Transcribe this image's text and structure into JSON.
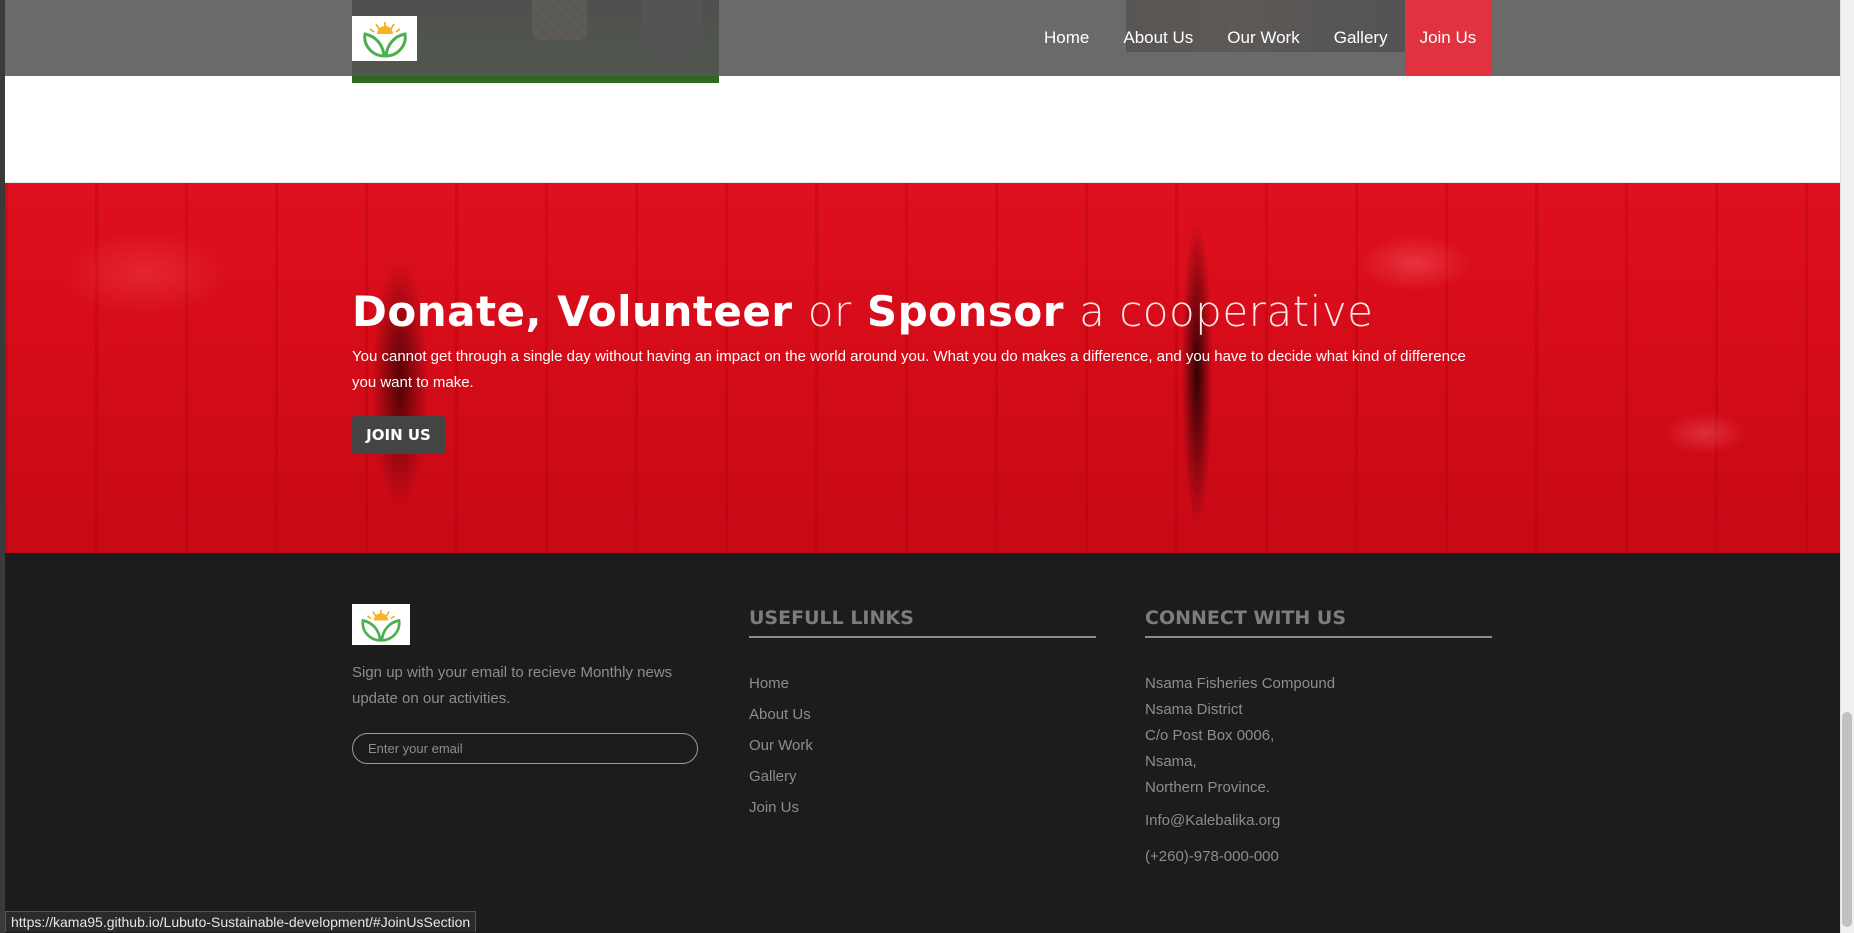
{
  "nav": {
    "items": [
      {
        "label": "Home"
      },
      {
        "label": "About Us"
      },
      {
        "label": "Our Work"
      },
      {
        "label": "Gallery"
      },
      {
        "label": "Join Us"
      }
    ]
  },
  "donate": {
    "title_bold_1": "Donate, Volunteer",
    "title_light_1": "or",
    "title_bold_2": "Sponsor",
    "title_light_2": "a cooperative",
    "text": "You cannot get through a single day without having an impact on the world around you. What you do makes a difference, and you have to decide what kind of difference you want to make.",
    "button_label": "JOIN US"
  },
  "footer": {
    "signup_text": "Sign up with your email to recieve Monthly news update on our activities.",
    "email_placeholder": "Enter your email",
    "links_title": "USEFULL LINKS",
    "links": [
      "Home",
      "About Us",
      "Our Work",
      "Gallery",
      "Join Us"
    ],
    "connect_title": "CONNECT WITH US",
    "address_lines": [
      "Nsama Fisheries Compound",
      "Nsama District",
      "C/o Post Box 0006,",
      "Nsama,",
      "Northern Province."
    ],
    "email": "Info@Kalebalika.org",
    "phone": "(+260)-978-000-000"
  },
  "status_bar": {
    "url": "https://kama95.github.io/Lubuto-Sustainable-development/#JoinUsSection"
  },
  "colors": {
    "accent": "#e0323f",
    "donate_red": "#d40b18",
    "footer_bg": "#1c1c1c",
    "button_dark": "#444444"
  },
  "icons": {
    "logo": "leaf-sun-logo-icon"
  }
}
